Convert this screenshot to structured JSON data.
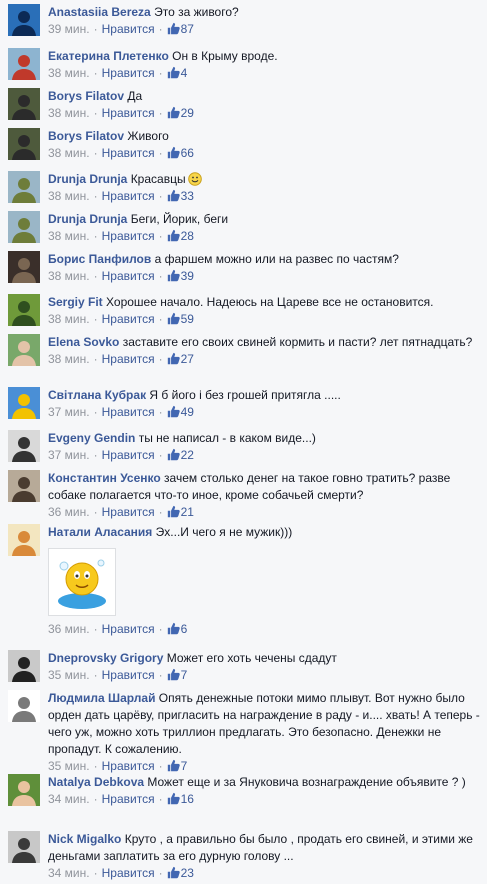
{
  "comments": [
    {
      "author": "Anastasiia Bereza",
      "text": "Это за живого?",
      "time": "39 мин.",
      "like": "Нравится",
      "count": "87",
      "avatar": "avatar-helmet",
      "colors": [
        "#2a6fb8",
        "#0c2a55"
      ]
    },
    {
      "author": "Екатерина Плетенко",
      "text": "Он в Крыму вроде.",
      "time": "38 мин.",
      "like": "Нравится",
      "count": "4",
      "avatar": "avatar-woman",
      "colors": [
        "#8db4d0",
        "#c0392b"
      ]
    },
    {
      "author": "Borys Filatov",
      "text": "Да",
      "time": "38 мин.",
      "like": "Нравится",
      "count": "29",
      "avatar": "avatar-man",
      "colors": [
        "#4e5a3c",
        "#2b2b2b"
      ]
    },
    {
      "author": "Borys Filatov",
      "text": "Живого",
      "time": "38 мин.",
      "like": "Нравится",
      "count": "66",
      "avatar": "avatar-man",
      "colors": [
        "#4e5a3c",
        "#2b2b2b"
      ]
    },
    {
      "author": "Drunja Drunja",
      "text": "Красавцы",
      "time": "38 мин.",
      "like": "Нравится",
      "count": "33",
      "avatar": "avatar-landscape",
      "colors": [
        "#9ab6c7",
        "#6e7d3a"
      ],
      "smiley": true
    },
    {
      "author": "Drunja Drunja",
      "text": "Беги, Йорик, беги",
      "time": "38 мин.",
      "like": "Нравится",
      "count": "28",
      "avatar": "avatar-landscape",
      "colors": [
        "#9ab6c7",
        "#6e7d3a"
      ]
    },
    {
      "author": "Борис Панфилов",
      "text": "а фаршем можно или на развес по частям?",
      "time": "38 мин.",
      "like": "Нравится",
      "count": "39",
      "avatar": "avatar-dark-man",
      "colors": [
        "#3a2f2a",
        "#7a6652"
      ]
    },
    {
      "author": "Sergiy Fit",
      "text": "Хорошее начало. Надеюсь на Цареве все не остановится.",
      "time": "38 мин.",
      "like": "Нравится",
      "count": "59",
      "avatar": "avatar-green",
      "colors": [
        "#6f9a3a",
        "#2f4f1f"
      ]
    },
    {
      "author": "Elena Sovko",
      "text": "заставите его своих свиней кормить и пасти? лет пятнадцать?",
      "time": "38 мин.",
      "like": "Нравится",
      "count": "27",
      "avatar": "avatar-woman-outdoor",
      "colors": [
        "#79a86a",
        "#e3c3a8"
      ]
    },
    {
      "author": "Світлана Кубрак",
      "text": "Я б його і без грошей притягла .....",
      "time": "37 мин.",
      "like": "Нравится",
      "count": "49",
      "avatar": "avatar-heart-flag",
      "colors": [
        "#4a8fd6",
        "#f2c200"
      ]
    },
    {
      "author": "Evgeny Gendin",
      "text": "ты не написал - в каком виде...)",
      "time": "37 мин.",
      "like": "Нравится",
      "count": "22",
      "avatar": "avatar-raccoon",
      "colors": [
        "#d9d9d9",
        "#333333"
      ]
    },
    {
      "author": "Константин Усенко",
      "text": "зачем столько денег на такое говно тратить? разве собаке полагается что-то иное, кроме собачьей смерти?",
      "time": "36 мин.",
      "like": "Нравится",
      "count": "21",
      "avatar": "avatar-man-glasses",
      "colors": [
        "#b7aa98",
        "#4a3c30"
      ]
    },
    {
      "author": "Натали Аласания",
      "text": "Эх...И чего я не мужик)))",
      "time": "36 мин.",
      "like": "Нравится",
      "count": "6",
      "avatar": "avatar-flowers",
      "colors": [
        "#f3e6c0",
        "#d98a3a"
      ],
      "sticker": true
    },
    {
      "author": "Dneprovsky Grigory",
      "text": "Может его хоть чечены сдадут",
      "time": "35 мин.",
      "like": "Нравится",
      "count": "7",
      "avatar": "avatar-hat",
      "colors": [
        "#c9c9c9",
        "#222222"
      ]
    },
    {
      "author": "Людмила Шарлай",
      "text": "Опять денежные потоки мимо плывут. Вот нужно было орден дать царёву, пригласить на награждение в раду - и.... хвать! А теперь - чего уж, можно хоть триллион предлагать. Это безопасно. Денежки не пропадут. К сожалению.",
      "time": "35 мин.",
      "like": "Нравится",
      "count": "7",
      "avatar": "avatar-sketch",
      "colors": [
        "#ffffff",
        "#7a7a7a"
      ]
    },
    {
      "author": "Natalya Debkova",
      "text": "Может еще и за Януковича вознаграждение объявите ? )",
      "time": "34 мин.",
      "like": "Нравится",
      "count": "16",
      "avatar": "avatar-green-woman",
      "colors": [
        "#5f8f3a",
        "#e9c3a0"
      ]
    },
    {
      "author": "Nick Migalko",
      "text": "Круто , а правильно бы было , продать его свиней, и этими же деньгами заплатить за его дурную голову ...",
      "time": "34 мин.",
      "like": "Нравится",
      "count": "23",
      "avatar": "avatar-man-sunglasses",
      "colors": [
        "#c8c8c8",
        "#3a3a3a"
      ]
    }
  ]
}
